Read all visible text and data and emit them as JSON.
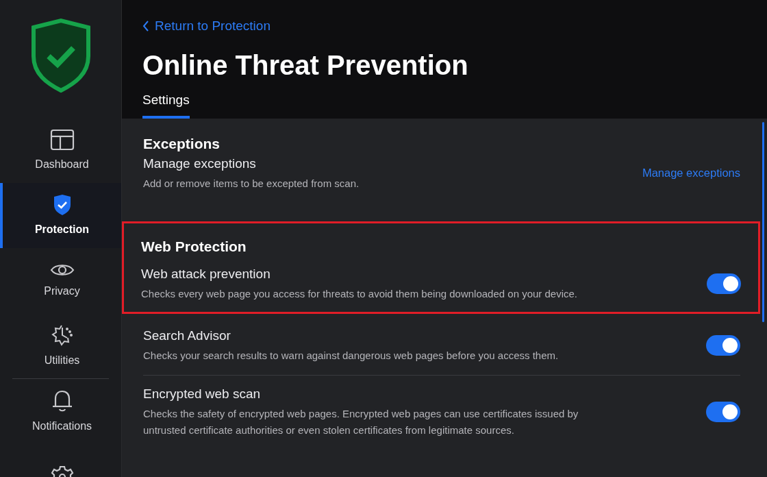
{
  "sidebar": {
    "items": [
      {
        "kind": "dashboard",
        "label": "Dashboard",
        "selected": false
      },
      {
        "kind": "protection",
        "label": "Protection",
        "selected": true
      },
      {
        "kind": "privacy",
        "label": "Privacy",
        "selected": false
      },
      {
        "kind": "utilities",
        "label": "Utilities",
        "selected": false
      },
      {
        "kind": "notifications",
        "label": "Notifications",
        "selected": false
      },
      {
        "kind": "settings",
        "selected": false
      }
    ]
  },
  "header": {
    "back_link": "Return to Protection",
    "title": "Online Threat Prevention",
    "tabs": [
      {
        "label": "Settings",
        "selected": true
      }
    ]
  },
  "sections": [
    {
      "title": "Exceptions",
      "highlighted": false,
      "rows": [
        {
          "kind": "link",
          "title": "Manage exceptions",
          "description": "Add or remove items to be excepted from scan.",
          "link": "Manage exceptions"
        }
      ]
    },
    {
      "title": "Web Protection",
      "highlighted": true,
      "rows": [
        {
          "kind": "toggle",
          "title": "Web attack prevention",
          "description": "Checks every web page you access for threats to avoid them being downloaded on your device.",
          "on": true
        }
      ]
    },
    {
      "highlighted": false,
      "rows": [
        {
          "kind": "toggle",
          "title": "Search Advisor",
          "description": "Checks your search results to warn against dangerous web pages before you access them.",
          "on": true
        },
        {
          "kind": "toggle",
          "title": "Encrypted web scan",
          "description": "Checks the safety of encrypted web pages. Encrypted web pages can use certificates issued by untrusted certificate authorities or even stolen certificates from legitimate sources.",
          "on": true
        }
      ]
    }
  ]
}
